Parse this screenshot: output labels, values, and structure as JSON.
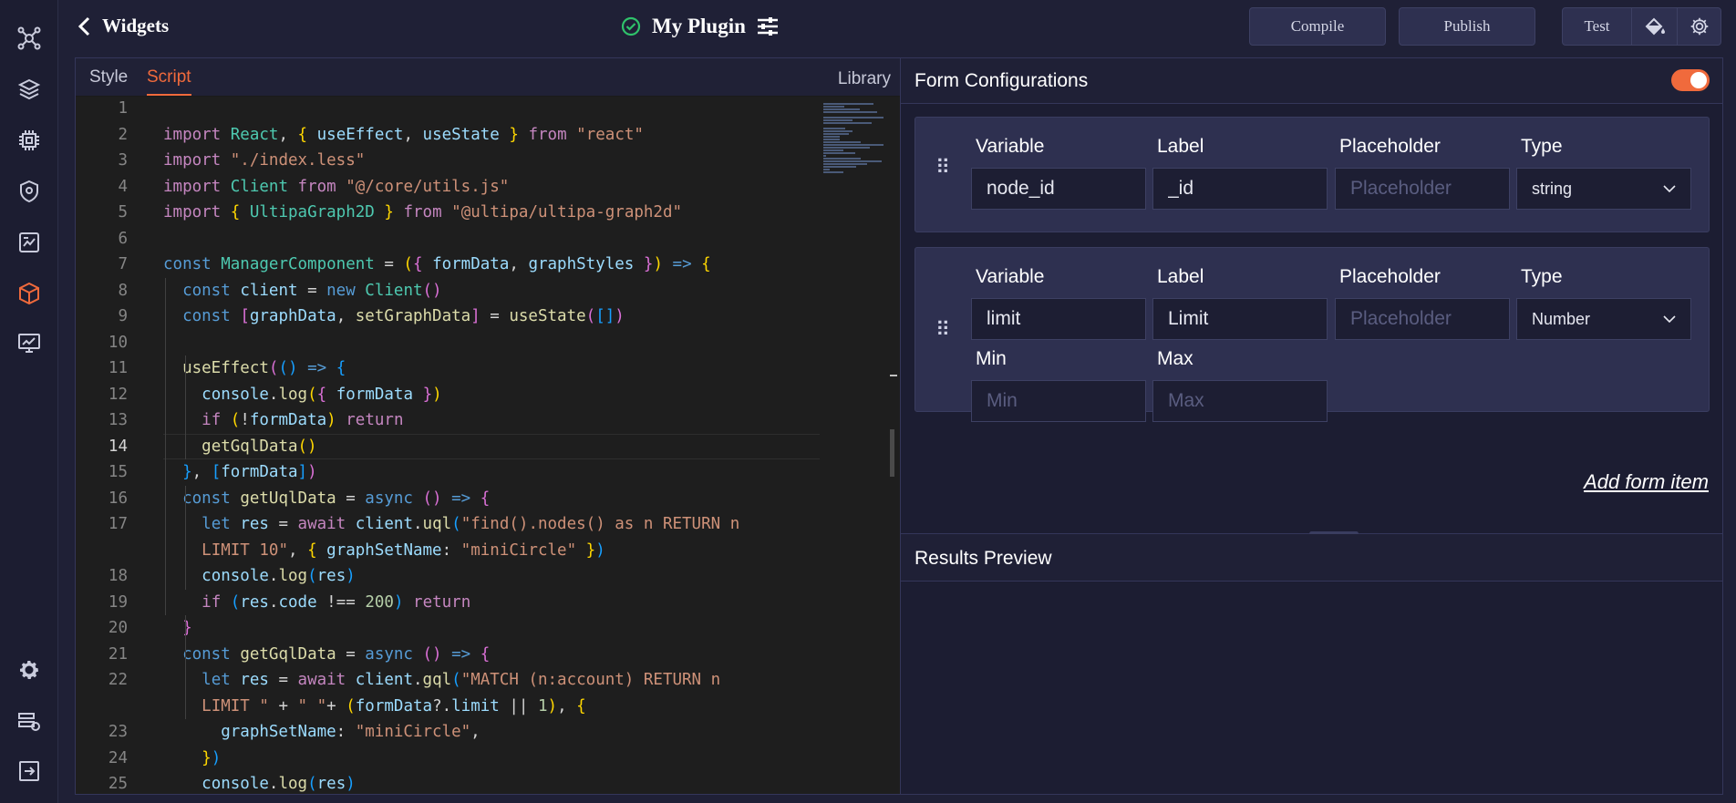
{
  "header": {
    "back_label": "Widgets",
    "title": "My Plugin",
    "compile_label": "Compile",
    "publish_label": "Publish",
    "test_label": "Test"
  },
  "sidebar": {
    "icons": [
      "cluster-icon",
      "layers-icon",
      "chip-icon",
      "shield-location-icon",
      "report-icon",
      "box-icon",
      "monitor-chart-icon",
      "settings-icon",
      "server-icon",
      "exit-icon"
    ],
    "active": "box-icon"
  },
  "editor": {
    "tabs": [
      {
        "label": "Style"
      },
      {
        "label": "Script"
      }
    ],
    "active_tab": "Script",
    "library_label": "Library",
    "current_line": "14",
    "lines": [
      {
        "n": "1",
        "html": ""
      },
      {
        "n": "2",
        "html": "<span class='kw2'>import</span> <span class='cls'>React</span>, <span class='b1'>{</span> <span class='var'>useEffect</span>, <span class='var'>useState</span> <span class='b1'>}</span> <span class='kw2'>from</span> <span class='str'>\"react\"</span>"
      },
      {
        "n": "3",
        "html": "<span class='kw2'>import</span> <span class='str'>\"./index.less\"</span>"
      },
      {
        "n": "4",
        "html": "<span class='kw2'>import</span> <span class='cls'>Client</span> <span class='kw2'>from</span> <span class='str'>\"@/core/utils.js\"</span>"
      },
      {
        "n": "5",
        "html": "<span class='kw2'>import</span> <span class='b1'>{</span> <span class='cls'>UltipaGraph2D</span> <span class='b1'>}</span> <span class='kw2'>from</span> <span class='str'>\"@ultipa/ultipa-graph2d\"</span>"
      },
      {
        "n": "6",
        "html": ""
      },
      {
        "n": "7",
        "html": "<span class='kw'>const</span> <span class='cls'>ManagerComponent</span> = <span class='b1'>(</span><span class='b2'>{</span> <span class='var'>formData</span>, <span class='var'>graphStyles</span> <span class='b2'>}</span><span class='b1'>)</span> <span class='kw'>=&gt;</span> <span class='b1'>{</span>"
      },
      {
        "n": "8",
        "html": "  <span class='kw'>const</span> <span class='var'>client</span> = <span class='kw'>new</span> <span class='cls'>Client</span><span class='b2'>()</span>"
      },
      {
        "n": "9",
        "html": "  <span class='kw'>const</span> <span class='b2'>[</span><span class='var'>graphData</span>, <span class='fn'>setGraphData</span><span class='b2'>]</span> = <span class='fn'>useState</span><span class='b2'>(</span><span class='b3'>[]</span><span class='b2'>)</span>"
      },
      {
        "n": "10",
        "html": ""
      },
      {
        "n": "11",
        "html": "  <span class='fn'>useEffect</span><span class='b2'>(</span><span class='b3'>()</span> <span class='kw'>=&gt;</span> <span class='b3'>{</span>"
      },
      {
        "n": "12",
        "html": "    <span class='var'>console</span>.<span class='fn'>log</span><span class='b1'>(</span><span class='b2'>{</span> <span class='var'>formData</span> <span class='b2'>}</span><span class='b1'>)</span>"
      },
      {
        "n": "13",
        "html": "    <span class='kw2'>if</span> <span class='b1'>(</span>!<span class='var'>formData</span><span class='b1'>)</span> <span class='kw2'>return</span>"
      },
      {
        "n": "14",
        "html": "    <span class='fn'>getGqlData</span><span class='b1'>()</span>"
      },
      {
        "n": "15",
        "html": "  <span class='b3'>}</span>, <span class='b3'>[</span><span class='var'>formData</span><span class='b3'>]</span><span class='b2'>)</span>"
      },
      {
        "n": "16",
        "html": "  <span class='kw'>const</span> <span class='fn'>getUqlData</span> = <span class='kw'>async</span> <span class='b2'>()</span> <span class='kw'>=&gt;</span> <span class='b2'>{</span>"
      },
      {
        "n": "17",
        "html": "    <span class='kw'>let</span> <span class='var'>res</span> = <span class='kw2'>await</span> <span class='var'>client</span>.<span class='fn'>uql</span><span class='b3'>(</span><span class='str'>\"find().nodes() as n RETURN n</span>"
      },
      {
        "n": "",
        "html": "    <span class='str'>LIMIT 10\"</span>, <span class='b1'>{</span> <span class='var'>graphSetName</span>: <span class='str'>\"miniCircle\"</span> <span class='b1'>}</span><span class='b3'>)</span>"
      },
      {
        "n": "18",
        "html": "    <span class='var'>console</span>.<span class='fn'>log</span><span class='b3'>(</span><span class='var'>res</span><span class='b3'>)</span>"
      },
      {
        "n": "19",
        "html": "    <span class='kw2'>if</span> <span class='b3'>(</span><span class='var'>res</span>.<span class='var'>code</span> !== <span class='num'>200</span><span class='b3'>)</span> <span class='kw2'>return</span>"
      },
      {
        "n": "20",
        "html": "  <span class='b2'>}</span>"
      },
      {
        "n": "21",
        "html": "  <span class='kw'>const</span> <span class='fn'>getGqlData</span> = <span class='kw'>async</span> <span class='b2'>()</span> <span class='kw'>=&gt;</span> <span class='b2'>{</span>"
      },
      {
        "n": "22",
        "html": "    <span class='kw'>let</span> <span class='var'>res</span> = <span class='kw2'>await</span> <span class='var'>client</span>.<span class='fn'>gql</span><span class='b3'>(</span><span class='str'>\"MATCH (n:account) RETURN n</span>"
      },
      {
        "n": "",
        "html": "    <span class='str'>LIMIT \"</span> + <span class='str'>\" \"</span>+ <span class='b1'>(</span><span class='var'>formData</span>?.<span class='var'>limit</span> || <span class='num'>1</span><span class='b1'>)</span>, <span class='b1'>{</span>"
      },
      {
        "n": "23",
        "html": "      <span class='var'>graphSetName</span>: <span class='str'>\"miniCircle\"</span>,"
      },
      {
        "n": "24",
        "html": "    <span class='b1'>}</span><span class='b3'>)</span>"
      },
      {
        "n": "25",
        "html": "    <span class='var'>console</span>.<span class='fn'>log</span><span class='b3'>(</span><span class='var'>res</span><span class='b3'>)</span>"
      }
    ]
  },
  "form_config": {
    "title": "Form Configurations",
    "enabled": true,
    "items": [
      {
        "fields": [
          {
            "label": "Variable",
            "value": "node_id",
            "placeholder": ""
          },
          {
            "label": "Label",
            "value": "_id",
            "placeholder": ""
          },
          {
            "label": "Placeholder",
            "value": "",
            "placeholder": "Placeholder"
          }
        ],
        "type_label": "Type",
        "type_value": "string"
      },
      {
        "fields": [
          {
            "label": "Variable",
            "value": "limit",
            "placeholder": ""
          },
          {
            "label": "Label",
            "value": "Limit",
            "placeholder": ""
          },
          {
            "label": "Placeholder",
            "value": "",
            "placeholder": "Placeholder"
          }
        ],
        "type_label": "Type",
        "type_value": "Number",
        "min_label": "Min",
        "min_placeholder": "Min",
        "max_label": "Max",
        "max_placeholder": "Max"
      }
    ],
    "add_label": "Add form item"
  },
  "results": {
    "title": "Results Preview"
  },
  "colors": {
    "accent": "#f06a3c",
    "success": "#2fc26b",
    "background": "#1f2036",
    "card": "#2e3050"
  }
}
